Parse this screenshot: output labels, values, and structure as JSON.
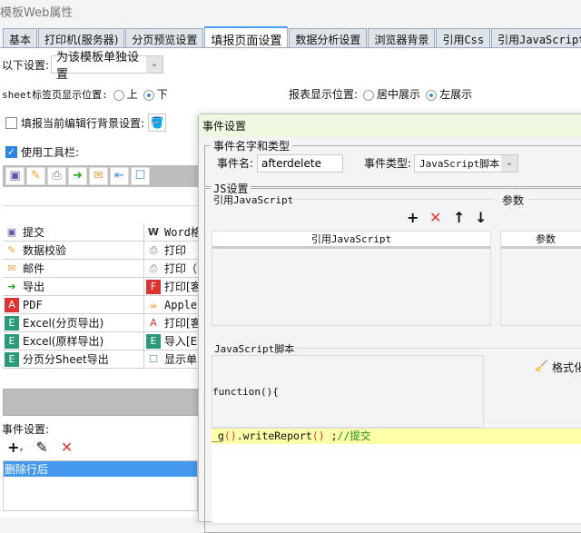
{
  "window": {
    "title": "模板Web属性",
    "close_icon": "close-icon"
  },
  "tabs": [
    {
      "label": "基本"
    },
    {
      "label": "打印机(服务器)"
    },
    {
      "label": "分页预览设置"
    },
    {
      "label": "填报页面设置",
      "active": true
    },
    {
      "label": "数据分析设置"
    },
    {
      "label": "浏览器背景"
    },
    {
      "label": "引用Css"
    },
    {
      "label": "引用JavaScript"
    }
  ],
  "settings": {
    "label": "以下设置:",
    "value": "为该模板单独设置"
  },
  "sheet_tab": {
    "label": "sheet标签页显示位置:",
    "options": [
      "上",
      "下"
    ],
    "selected": "下"
  },
  "report_pos": {
    "label": "报表显示位置:",
    "options": [
      "居中展示",
      "左展示"
    ],
    "selected": "左展示"
  },
  "row_bg": {
    "label": "填报当前编辑行背景设置:",
    "checked": false
  },
  "toolbar": {
    "label": "使用工具栏:",
    "checked": true
  },
  "buttons": [
    [
      "提交",
      "Word格式"
    ],
    [
      "数据校验",
      "打印"
    ],
    [
      "邮件",
      "打印（"
    ],
    [
      "导出",
      "打印[客"
    ],
    [
      "PDF",
      "Applet"
    ],
    [
      "Excel(分页导出)",
      "打印[客"
    ],
    [
      "Excel(原样导出)",
      "导入[E"
    ],
    [
      "分页分Sheet导出",
      "显示单"
    ]
  ],
  "events": {
    "label": "事件设置:",
    "items": [
      "删除行后"
    ],
    "selected": "删除行后"
  },
  "dialog": {
    "title": "事件设置",
    "name_group": "事件名字和类型",
    "name_label": "事件名:",
    "name_value": "afterdelete",
    "type_label": "事件类型:",
    "type_value": "JavaScript脚本",
    "js_group": "JS设置",
    "ref_label": "引用JavaScript",
    "param_label": "参数",
    "ref_col": "引用JavaScript",
    "param_col": "参数",
    "script_label": "JavaScript脚本",
    "format_label": "格式化",
    "code_head": "function(){",
    "code_line": {
      "a": "_g",
      "b": "()",
      ".": ".writeReport",
      "c": "()",
      "d": " ;",
      "comment": "//提交"
    }
  },
  "colors": {
    "accent": "#4499ee",
    "highlight": "#ffffaa",
    "dialog_title": "#eef7e0",
    "delete": "#e53935"
  }
}
